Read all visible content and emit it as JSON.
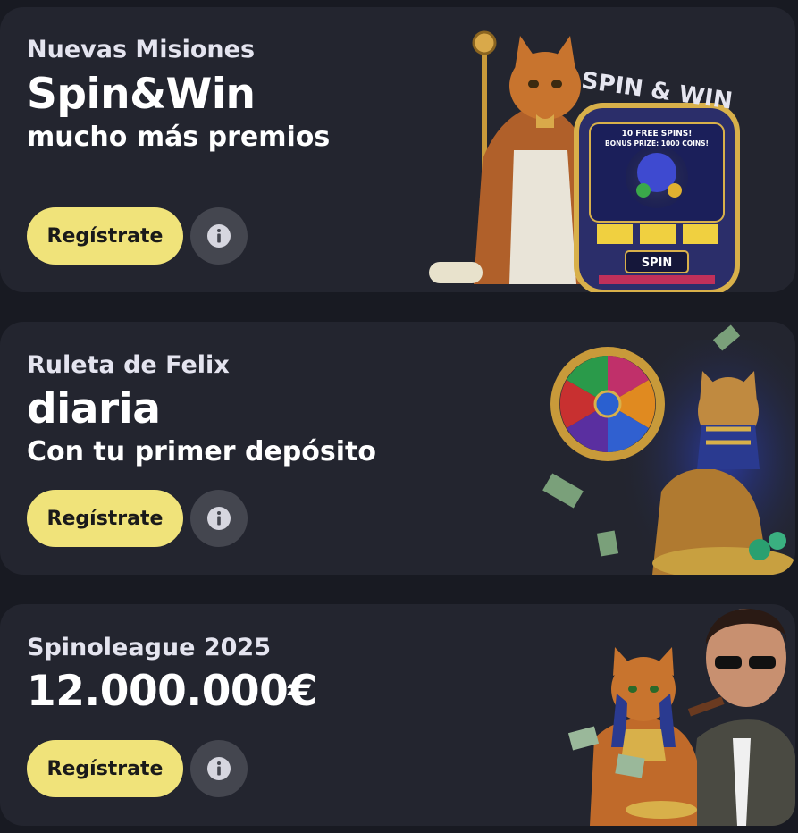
{
  "cards": [
    {
      "subtitle": "Nuevas Misiones",
      "title": "Spin&Win",
      "tagline": "mucho más premios",
      "cta_label": "Regístrate",
      "art_text": {
        "sign": "SPIN & WIN",
        "screen_line1": "10 FREE SPINS!",
        "screen_line2": "BONUS PRIZE: 1000 COINS!",
        "button": "SPIN"
      }
    },
    {
      "subtitle": "Ruleta de Felix",
      "title": "diaria",
      "tagline": "Con tu primer depósito",
      "cta_label": "Regístrate"
    },
    {
      "subtitle": "Spinoleague 2025",
      "title": "12.000.000€",
      "cta_label": "Regístrate"
    }
  ],
  "icons": {
    "info": "info-circle-icon"
  },
  "colors": {
    "background": "#181a22",
    "card": "#23252f",
    "cta": "#f0e37a",
    "info_button": "#44464f"
  }
}
